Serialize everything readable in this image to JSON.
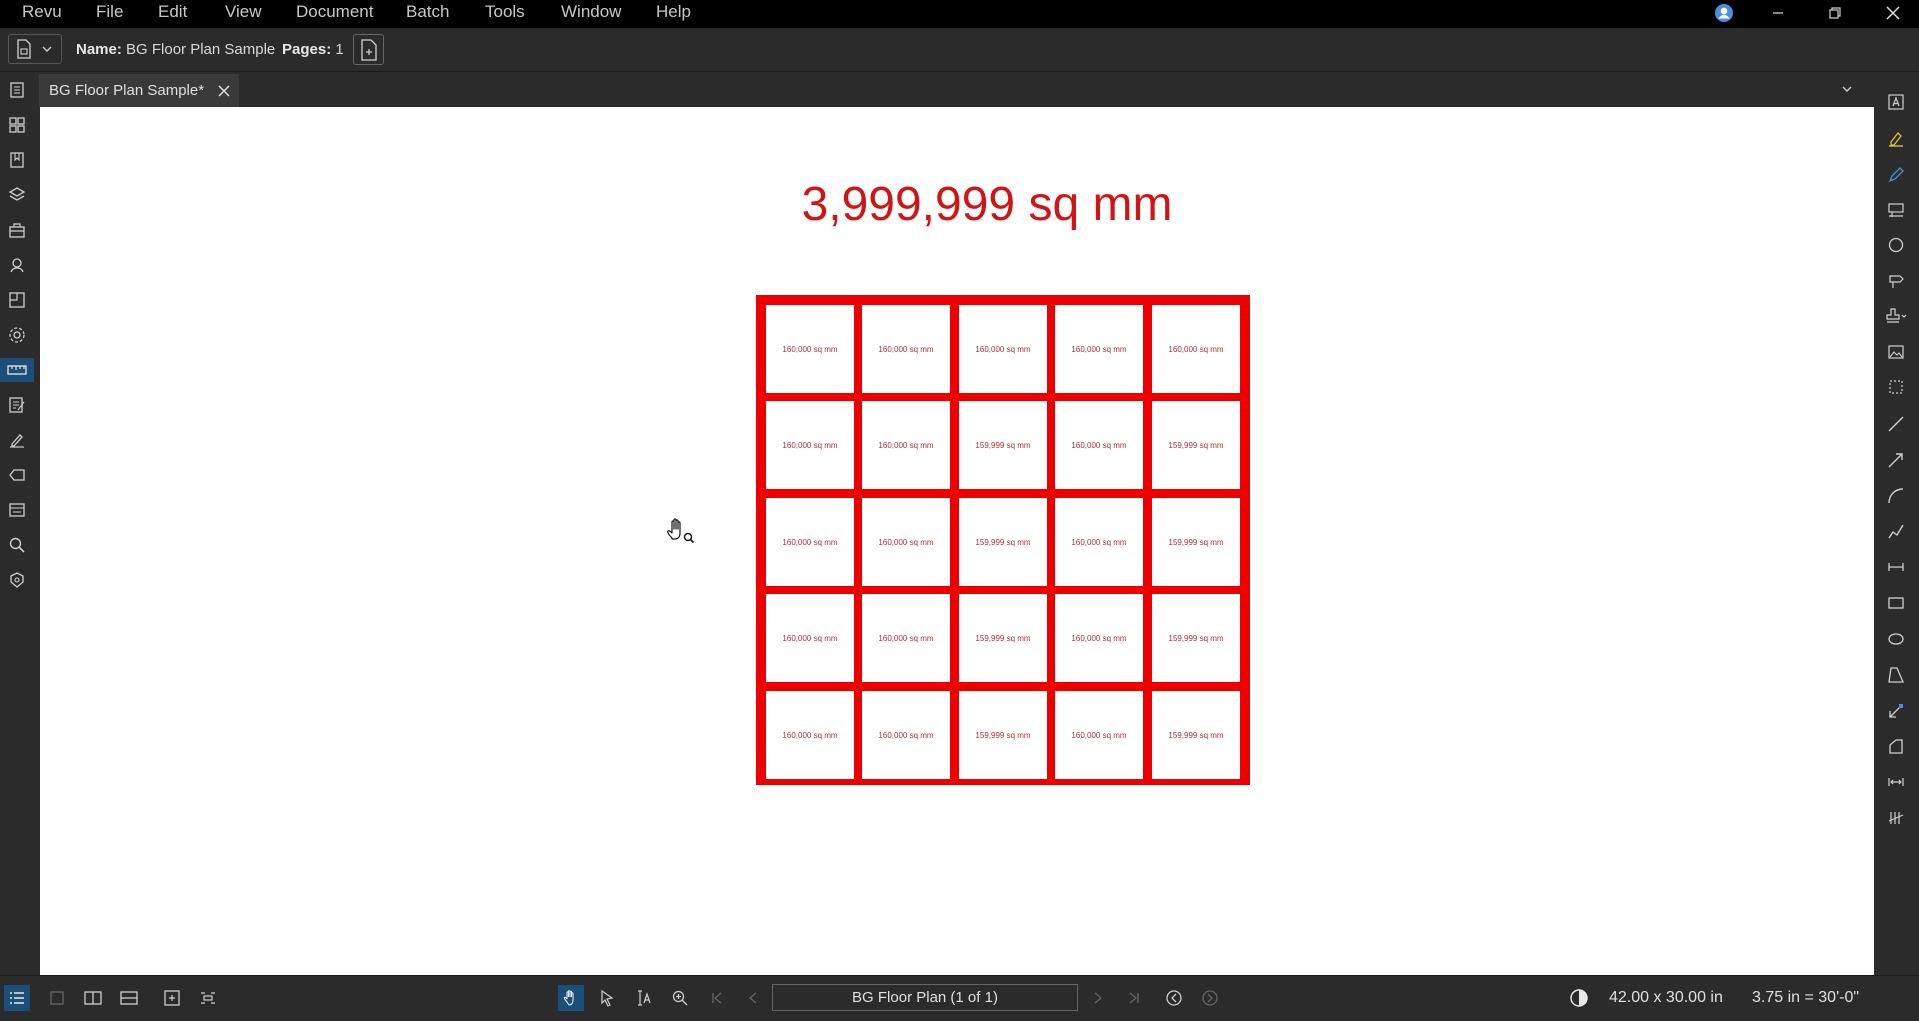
{
  "menubar": {
    "items": [
      "Revu",
      "File",
      "Edit",
      "View",
      "Document",
      "Batch",
      "Tools",
      "Window",
      "Help"
    ],
    "account_icon": "user-account-icon",
    "window_controls": [
      "minimize-icon",
      "restore-icon",
      "close-icon"
    ]
  },
  "toolbar": {
    "name_label": "Name:",
    "name_value": "BG Floor Plan Sample",
    "pages_label": "Pages:",
    "pages_value": "1"
  },
  "tabs": [
    {
      "label": "BG Floor Plan Sample*",
      "active": true
    }
  ],
  "left_sidebar": {
    "icons": [
      "thumbnails-icon",
      "file-access-icon",
      "bookmarks-icon",
      "layers-icon",
      "tool-chest-icon",
      "properties-icon",
      "measurements-icon",
      "settings-icon",
      "ruler-icon",
      "markups-list-icon",
      "signatures-icon",
      "tags-icon",
      "sets-icon",
      "search-icon",
      "studio-icon"
    ],
    "active": "ruler-icon"
  },
  "right_sidebar": {
    "icons": [
      "text-box-icon",
      "highlighter-icon",
      "pen-icon",
      "callout-icon",
      "shape-icon",
      "cloud-icon",
      "stamp-icon",
      "image-icon",
      "snapshot-icon",
      "line-icon",
      "arrow-icon",
      "arc-icon",
      "polyline-icon",
      "dimension-icon",
      "rectangle-icon",
      "ellipse-icon",
      "polygon-icon",
      "area-measure-icon",
      "perimeter-icon",
      "length-measure-icon",
      "count-icon"
    ]
  },
  "document": {
    "total_area": "3,999,999 sq mm",
    "cells": [
      [
        "160,000 sq mm",
        "160,000 sq mm",
        "160,000 sq mm",
        "160,000 sq mm",
        "160,000 sq mm"
      ],
      [
        "160,000 sq mm",
        "160,000 sq mm",
        "159,999 sq mm",
        "160,000 sq mm",
        "159,999 sq mm"
      ],
      [
        "160,000 sq mm",
        "160,000 sq mm",
        "159,999 sq mm",
        "160,000 sq mm",
        "159,999 sq mm"
      ],
      [
        "160,000 sq mm",
        "160,000 sq mm",
        "159,999 sq mm",
        "160,000 sq mm",
        "159,999 sq mm"
      ],
      [
        "160,000 sq mm",
        "160,000 sq mm",
        "159,999 sq mm",
        "160,000 sq mm",
        "159,999 sq mm"
      ]
    ],
    "markup_color": "#ee0000",
    "text_color": "#d11414"
  },
  "statusbar": {
    "page_field": "BG Floor Plan (1 of 1)",
    "page_size": "42.00 x 30.00 in",
    "scale": "3.75 in = 30'-0\"",
    "active_tool": "pan-icon"
  }
}
